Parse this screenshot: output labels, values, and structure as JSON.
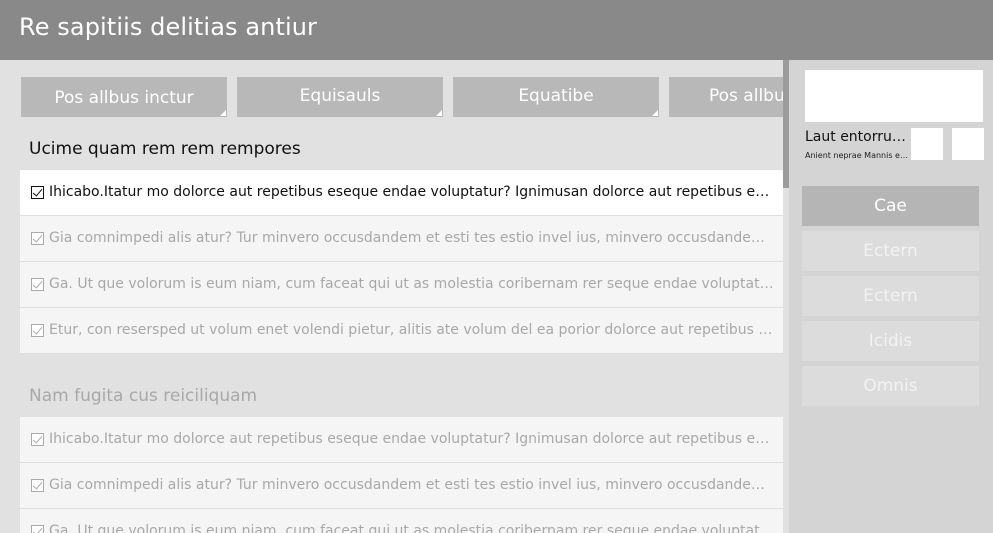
{
  "header": {
    "title": "Re sapitiis delitias antiur"
  },
  "tabs": [
    {
      "label": "Pos allbus inctur"
    },
    {
      "label": "Equisauls"
    },
    {
      "label": "Equatibe"
    },
    {
      "label": "Pos allbus"
    }
  ],
  "sections": [
    {
      "title": "Ucime quam rem rem rempores",
      "items": [
        {
          "text": "Ihicabo.Itatur mo dolorce aut repetibus eseque endae voluptatur? Ignimusan dolorce aut repetibus eseques…",
          "checked": true
        },
        {
          "text": "Gia comnimpedi alis atur? Tur minvero occusdandem et esti tes estio invel ius, minvero occusdandem et esti…",
          "checked": true
        },
        {
          "text": "Ga. Ut que volorum is eum niam, cum faceat qui ut as molestia coribernam rer seque endae voluptatur seque…",
          "checked": true
        },
        {
          "text": "Etur, con resersped ut volum enet volendi pietur, alitis ate volum del ea porior dolorce aut repetibus esequed…",
          "checked": true
        }
      ]
    },
    {
      "title": "Nam fugita cus reiciliquam",
      "items": [
        {
          "text": "Ihicabo.Itatur mo dolorce aut repetibus eseque endae voluptatur? Ignimusan dolorce aut repetibus eseques…",
          "checked": true
        },
        {
          "text": "Gia comnimpedi alis atur? Tur minvero occusdandem et esti tes estio invel ius, minvero occusdandem et esti…",
          "checked": true
        },
        {
          "text": "Ga. Ut que volorum is eum niam, cum faceat qui ut as molestia coribernam rer seque endae voluptatur seque…",
          "checked": true
        }
      ]
    }
  ],
  "side_panel": {
    "card": {
      "name": "Laut entorru…",
      "subtitle": "Anient neprae Mannis e…"
    },
    "buttons": [
      {
        "label": "Cae",
        "state": "active"
      },
      {
        "label": "Ectern",
        "state": "inactive"
      },
      {
        "label": "Ectern",
        "state": "inactive"
      },
      {
        "label": "Icidis",
        "state": "inactive"
      },
      {
        "label": "Omnis",
        "state": "inactive"
      }
    ]
  },
  "colors": {
    "header_bg": "#898989",
    "tab_bg": "#b8b8b8",
    "panel_bg": "#d4d4d4",
    "active_button": "#b5b5b5"
  }
}
